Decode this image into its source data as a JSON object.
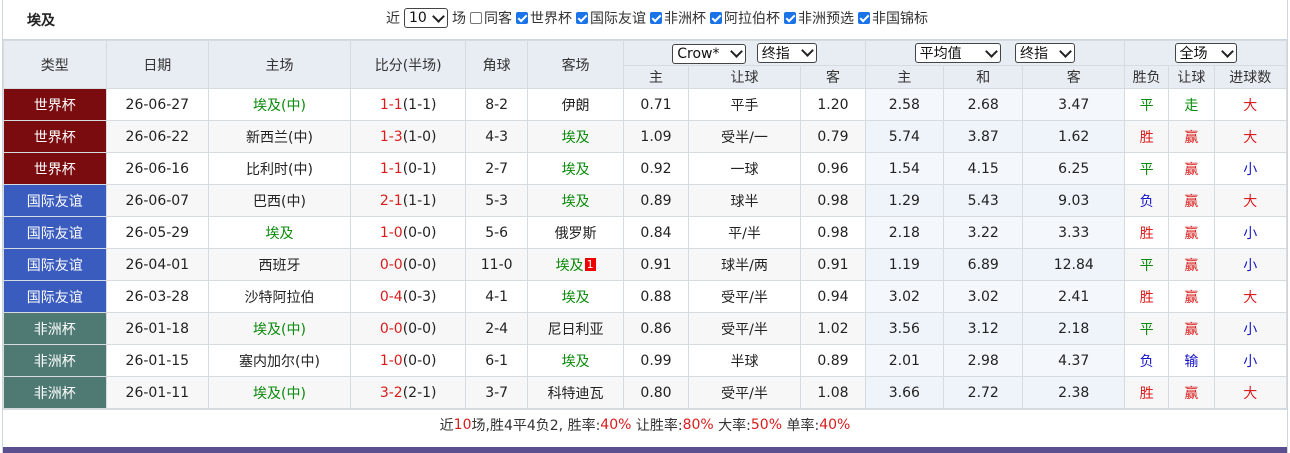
{
  "header": {
    "team": "埃及",
    "recent_prefix": "近",
    "recent_count": "10",
    "recent_suffix": "场",
    "filters": [
      {
        "label": "同客",
        "checked": false
      },
      {
        "label": "世界杯",
        "checked": true
      },
      {
        "label": "国际友谊",
        "checked": true
      },
      {
        "label": "非洲杯",
        "checked": true
      },
      {
        "label": "阿拉伯杯",
        "checked": true
      },
      {
        "label": "非洲预选",
        "checked": true
      },
      {
        "label": "非国锦标",
        "checked": true
      }
    ]
  },
  "columns": {
    "type": "类型",
    "date": "日期",
    "home": "主场",
    "score": "比分(半场)",
    "corners": "角球",
    "away": "客场",
    "company_select": "Crow*",
    "odds_type_select_1": "终指",
    "average_select": "平均值",
    "odds_type_select_2": "终指",
    "scope_select": "全场",
    "ah_home": "主",
    "ah_line": "让球",
    "ah_away": "客",
    "eu_home": "主",
    "eu_draw": "和",
    "eu_away": "客",
    "result": "胜负",
    "handicap_result": "让球",
    "goals_result": "进球数"
  },
  "colors": {
    "world_cup": "#7a0c10",
    "friendly": "#3a5cbf",
    "africa_cup": "#4f7a74",
    "win": "#d91c1c",
    "draw": "#0a8a0a",
    "loss": "#1414c8"
  },
  "rows": [
    {
      "type": "世界杯",
      "date": "26-06-27",
      "home": "埃及(中)",
      "score": "1-1",
      "half": "(1-1)",
      "corners": "8-2",
      "away": "伊朗",
      "red_card": "",
      "ah_home": "0.71",
      "ah_line": "平手",
      "ah_away": "1.20",
      "eu_home": "2.58",
      "eu_draw": "2.68",
      "eu_away": "3.47",
      "result": "平",
      "handicap": "走",
      "goals": "大"
    },
    {
      "type": "世界杯",
      "date": "26-06-22",
      "home": "新西兰(中)",
      "score": "1-3",
      "half": "(1-0)",
      "corners": "4-3",
      "away": "埃及",
      "red_card": "",
      "ah_home": "1.09",
      "ah_line": "受半/一",
      "ah_away": "0.79",
      "eu_home": "5.74",
      "eu_draw": "3.87",
      "eu_away": "1.62",
      "result": "胜",
      "handicap": "赢",
      "goals": "大"
    },
    {
      "type": "世界杯",
      "date": "26-06-16",
      "home": "比利时(中)",
      "score": "1-1",
      "half": "(0-1)",
      "corners": "2-7",
      "away": "埃及",
      "red_card": "",
      "ah_home": "0.92",
      "ah_line": "一球",
      "ah_away": "0.96",
      "eu_home": "1.54",
      "eu_draw": "4.15",
      "eu_away": "6.25",
      "result": "平",
      "handicap": "赢",
      "goals": "小"
    },
    {
      "type": "国际友谊",
      "date": "26-06-07",
      "home": "巴西(中)",
      "score": "2-1",
      "half": "(1-1)",
      "corners": "5-3",
      "away": "埃及",
      "red_card": "",
      "ah_home": "0.89",
      "ah_line": "球半",
      "ah_away": "0.98",
      "eu_home": "1.29",
      "eu_draw": "5.43",
      "eu_away": "9.03",
      "result": "负",
      "handicap": "赢",
      "goals": "大"
    },
    {
      "type": "国际友谊",
      "date": "26-05-29",
      "home": "埃及",
      "score": "1-0",
      "half": "(0-0)",
      "corners": "5-6",
      "away": "俄罗斯",
      "red_card": "",
      "ah_home": "0.84",
      "ah_line": "平/半",
      "ah_away": "0.98",
      "eu_home": "2.18",
      "eu_draw": "3.22",
      "eu_away": "3.33",
      "result": "胜",
      "handicap": "赢",
      "goals": "小"
    },
    {
      "type": "国际友谊",
      "date": "26-04-01",
      "home": "西班牙",
      "score": "0-0",
      "half": "(0-0)",
      "corners": "11-0",
      "away": "埃及",
      "red_card": "1",
      "ah_home": "0.91",
      "ah_line": "球半/两",
      "ah_away": "0.91",
      "eu_home": "1.19",
      "eu_draw": "6.89",
      "eu_away": "12.84",
      "result": "平",
      "handicap": "赢",
      "goals": "小"
    },
    {
      "type": "国际友谊",
      "date": "26-03-28",
      "home": "沙特阿拉伯",
      "score": "0-4",
      "half": "(0-3)",
      "corners": "4-1",
      "away": "埃及",
      "red_card": "",
      "ah_home": "0.88",
      "ah_line": "受平/半",
      "ah_away": "0.94",
      "eu_home": "3.02",
      "eu_draw": "3.02",
      "eu_away": "2.41",
      "result": "胜",
      "handicap": "赢",
      "goals": "大"
    },
    {
      "type": "非洲杯",
      "date": "26-01-18",
      "home": "埃及(中)",
      "score": "0-0",
      "half": "(0-0)",
      "corners": "2-4",
      "away": "尼日利亚",
      "red_card": "",
      "ah_home": "0.86",
      "ah_line": "受平/半",
      "ah_away": "1.02",
      "eu_home": "3.56",
      "eu_draw": "3.12",
      "eu_away": "2.18",
      "result": "平",
      "handicap": "赢",
      "goals": "小"
    },
    {
      "type": "非洲杯",
      "date": "26-01-15",
      "home": "塞内加尔(中)",
      "score": "1-0",
      "half": "(0-0)",
      "corners": "6-1",
      "away": "埃及",
      "red_card": "",
      "ah_home": "0.99",
      "ah_line": "半球",
      "ah_away": "0.89",
      "eu_home": "2.01",
      "eu_draw": "2.98",
      "eu_away": "4.37",
      "result": "负",
      "handicap": "输",
      "goals": "小"
    },
    {
      "type": "非洲杯",
      "date": "26-01-11",
      "home": "埃及(中)",
      "score": "3-2",
      "half": "(2-1)",
      "corners": "3-7",
      "away": "科特迪瓦",
      "red_card": "",
      "ah_home": "0.80",
      "ah_line": "受平/半",
      "ah_away": "1.08",
      "eu_home": "3.66",
      "eu_draw": "2.72",
      "eu_away": "2.38",
      "result": "胜",
      "handicap": "赢",
      "goals": "大"
    }
  ],
  "summary": {
    "prefix": "近",
    "count": "10",
    "record": "场,胜4平4负2, 胜率:",
    "win_rate": "40%",
    "handicap_label": " 让胜率:",
    "handicap_rate": "80%",
    "over_label": " 大率:",
    "over_rate": "50%",
    "odd_label": " 单率:",
    "odd_rate": "40%"
  }
}
